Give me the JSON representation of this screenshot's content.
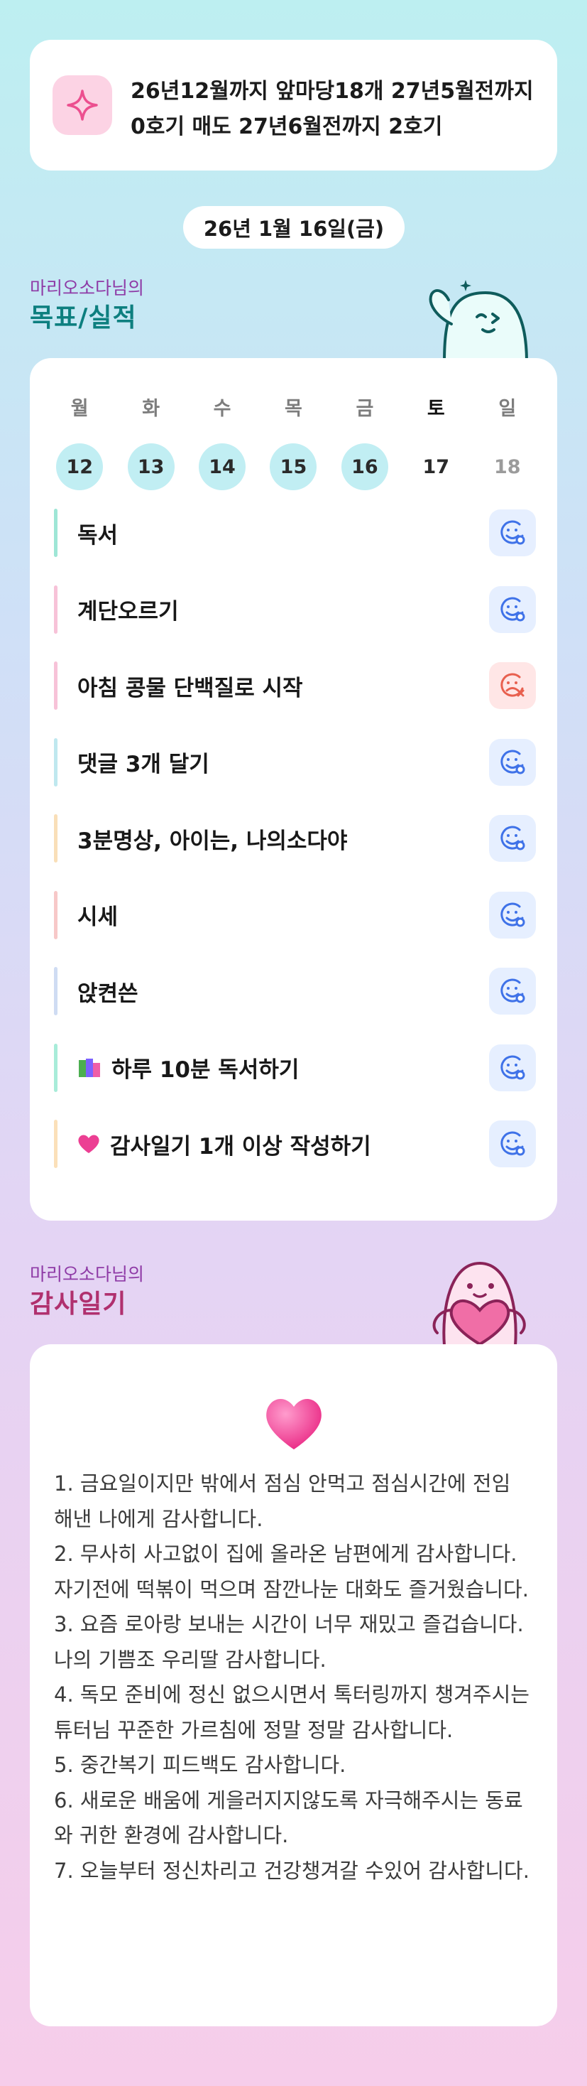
{
  "goal": {
    "icon": "sparkle-icon",
    "text": "26년12월까지 앞마당18개 27년5월전까지 0호기 매도 27년6월전까지 2호기"
  },
  "date": "26년 1월 16일(금)",
  "goals_section": {
    "subtitle": "마리오소다님의",
    "title": "목표/실적"
  },
  "week": [
    {
      "name": "월",
      "num": "12",
      "done": true
    },
    {
      "name": "화",
      "num": "13",
      "done": true
    },
    {
      "name": "수",
      "num": "14",
      "done": true
    },
    {
      "name": "목",
      "num": "15",
      "done": true
    },
    {
      "name": "금",
      "num": "16",
      "done": true
    },
    {
      "name": "토",
      "num": "17",
      "done": false
    },
    {
      "name": "일",
      "num": "18",
      "done": false
    }
  ],
  "tasks": [
    {
      "label": "독서",
      "color": "#9ee6d6",
      "status": "ok"
    },
    {
      "label": "계단오르기",
      "color": "#f7c2d8",
      "status": "ok"
    },
    {
      "label": "아침 콩물 단백질로 시작",
      "color": "#f7c2d8",
      "status": "fail"
    },
    {
      "label": "댓글 3개 달기",
      "color": "#bfe8ef",
      "status": "ok"
    },
    {
      "label": "3분명상, 아이는, 나의소다야",
      "color": "#f9dfb8",
      "status": "ok"
    },
    {
      "label": "시세",
      "color": "#f7c8c8",
      "status": "ok"
    },
    {
      "label": "앉켠쓴",
      "color": "#cfdcf3",
      "status": "ok"
    },
    {
      "label": "하루 10분 독서하기",
      "color": "#a8ecd9",
      "status": "ok",
      "emoji": "books-icon"
    },
    {
      "label": "감사일기 1개 이상 작성하기",
      "color": "#fbe0b9",
      "status": "ok",
      "emoji": "heart-icon"
    }
  ],
  "gratitude_section": {
    "subtitle": "마리오소다님의",
    "title": "감사일기"
  },
  "gratitude": {
    "icon": "heart-icon",
    "lines": [
      "1. 금요일이지만 밖에서 점심 안먹고 점심시간에 전임 해낸 나에게 감사합니다.",
      "2. 무사히 사고없이 집에 올라온 남편에게 감사합니다. 자기전에 떡볶이 먹으며 잠깐나눈 대화도 즐거웠습니다.",
      "3. 요즘 로아랑 보내는 시간이 너무 재밌고 즐겁습니다. 나의 기쁨조 우리딸 감사합니다.",
      "4. 독모 준비에 정신 없으시면서 톡터링까지 챙겨주시는 튜터님 꾸준한 가르침에 정말 정말 감사합니다.",
      "5. 중간복기 피드백도 감사합니다.",
      "6. 새로운 배움에 게을러지지않도록 자극해주시는 동료와 귀한 환경에 감사합니다.",
      "7. 오늘부터 정신차리고 건강챙겨갈 수있어 감사합니다."
    ]
  }
}
